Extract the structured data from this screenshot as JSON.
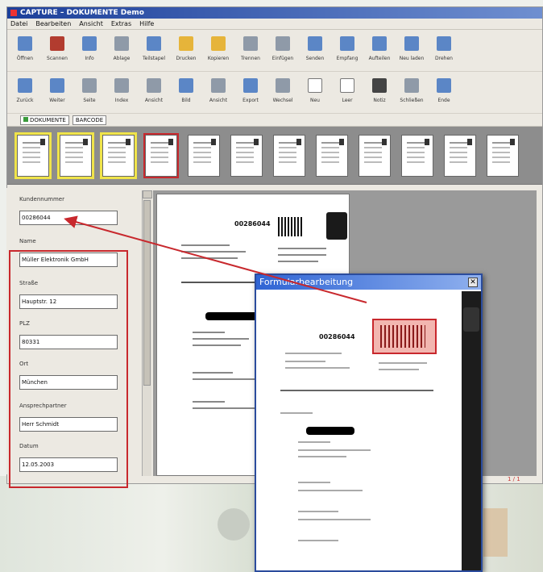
{
  "window": {
    "title": "CAPTURE – DOKUMENTE Demo"
  },
  "menu": [
    "Datei",
    "Bearbeiten",
    "Ansicht",
    "Extras",
    "Hilfe"
  ],
  "toolbar_row1": [
    {
      "label": "Öffnen",
      "icon": "scan-icon",
      "color": "blue"
    },
    {
      "label": "Scannen",
      "icon": "scanner-icon",
      "color": "red"
    },
    {
      "label": "Info",
      "icon": "info-icon",
      "color": "blue"
    },
    {
      "label": "Ablage",
      "icon": "drop-icon",
      "color": "gray"
    },
    {
      "label": "Teilstapel",
      "icon": "split-icon",
      "color": "blue"
    },
    {
      "label": "Drucken",
      "icon": "folder-icon",
      "color": "yellow"
    },
    {
      "label": "Kopieren",
      "icon": "folder-copy-icon",
      "color": "yellow"
    },
    {
      "label": "Trennen",
      "icon": "cut-icon",
      "color": "gray"
    },
    {
      "label": "Einfügen",
      "icon": "paste-icon",
      "color": "gray"
    },
    {
      "label": "Senden",
      "icon": "send-icon",
      "color": "blue"
    },
    {
      "label": "Empfang",
      "icon": "receive-icon",
      "color": "blue"
    },
    {
      "label": "Aufteilen",
      "icon": "split-pages-icon",
      "color": "blue"
    },
    {
      "label": "Neu laden",
      "icon": "reload-icon",
      "color": "blue"
    },
    {
      "label": "Drehen",
      "icon": "rotate-icon",
      "color": "blue"
    }
  ],
  "toolbar_row2": [
    {
      "label": "Zurück",
      "icon": "page-back-icon",
      "color": "blue"
    },
    {
      "label": "Weiter",
      "icon": "page-next-icon",
      "color": "blue"
    },
    {
      "label": "Seite",
      "icon": "page-icon",
      "color": "gray"
    },
    {
      "label": "Index",
      "icon": "index-icon",
      "color": "gray"
    },
    {
      "label": "Ansicht",
      "icon": "view-icon",
      "color": "gray"
    },
    {
      "label": "Bild",
      "icon": "image-icon",
      "color": "blue"
    },
    {
      "label": "Ansicht",
      "icon": "view2-icon",
      "color": "gray"
    },
    {
      "label": "Export",
      "icon": "export-icon",
      "color": "blue"
    },
    {
      "label": "Wechsel",
      "icon": "switch-icon",
      "color": "gray"
    },
    {
      "label": "Neu",
      "icon": "new-icon",
      "color": "page"
    },
    {
      "label": "Leer",
      "icon": "blank-icon",
      "color": "page"
    },
    {
      "label": "Notiz",
      "icon": "note-icon",
      "color": "dark"
    },
    {
      "label": "Schließen",
      "icon": "close-doc-icon",
      "color": "gray"
    },
    {
      "label": "Ende",
      "icon": "exit-icon",
      "color": "blue"
    }
  ],
  "tabs": [
    "DOKUMENTE",
    "BARCODE"
  ],
  "form": {
    "fields": [
      {
        "label": "Kundennummer",
        "value": "00286044"
      },
      {
        "label": "Name",
        "value": "Müller Elektronik GmbH"
      },
      {
        "label": "Straße",
        "value": "Hauptstr. 12"
      },
      {
        "label": "PLZ",
        "value": "80331"
      },
      {
        "label": "Ort",
        "value": "München"
      },
      {
        "label": "Ansprechpartner",
        "value": "Herr Schmidt"
      },
      {
        "label": "Datum",
        "value": "12.05.2003"
      }
    ]
  },
  "document": {
    "number": "00286044"
  },
  "dialog": {
    "title": "Formularbearbeitung",
    "close": "✕",
    "number": "00286044"
  },
  "statusbar": {
    "page": "1 / 1"
  }
}
